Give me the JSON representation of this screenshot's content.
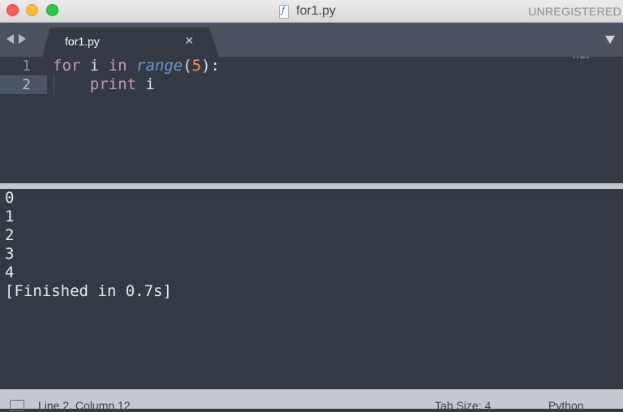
{
  "window": {
    "title": "for1.py",
    "license_status": "UNREGISTERED"
  },
  "tabs": [
    {
      "label": "for1.py",
      "close_glyph": "×",
      "active": true
    }
  ],
  "editor": {
    "language": "Python",
    "lines": [
      {
        "number": "1",
        "code": "for i in range(5):"
      },
      {
        "number": "2",
        "code": "    print i"
      }
    ],
    "active_line": 2
  },
  "output": {
    "lines": [
      "0",
      "1",
      "2",
      "3",
      "4",
      "[Finished in 0.7s]"
    ]
  },
  "statusbar": {
    "position": "Line 2, Column 12",
    "tab_size": "Tab Size: 4",
    "syntax": "Python"
  },
  "colors": {
    "background": "#343a44",
    "tab_bar": "#4b5360",
    "keyword": "#c594c5",
    "function": "#6699cc",
    "number": "#f99157",
    "text": "#d8dee9"
  },
  "icons": [
    "close-window-icon",
    "minimize-window-icon",
    "zoom-window-icon",
    "python-file-icon",
    "back-arrow-icon",
    "forward-arrow-icon",
    "close-tab-icon",
    "tab-menu-icon",
    "panel-toggle-icon"
  ]
}
